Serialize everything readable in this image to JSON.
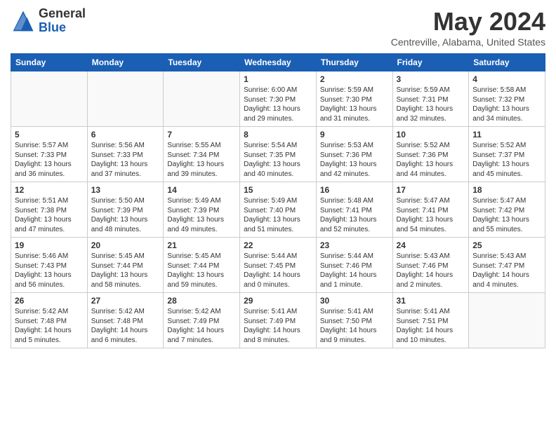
{
  "logo": {
    "general": "General",
    "blue": "Blue"
  },
  "title": "May 2024",
  "location": "Centreville, Alabama, United States",
  "weekdays": [
    "Sunday",
    "Monday",
    "Tuesday",
    "Wednesday",
    "Thursday",
    "Friday",
    "Saturday"
  ],
  "weeks": [
    [
      {
        "day": "",
        "info": ""
      },
      {
        "day": "",
        "info": ""
      },
      {
        "day": "",
        "info": ""
      },
      {
        "day": "1",
        "info": "Sunrise: 6:00 AM\nSunset: 7:30 PM\nDaylight: 13 hours\nand 29 minutes."
      },
      {
        "day": "2",
        "info": "Sunrise: 5:59 AM\nSunset: 7:30 PM\nDaylight: 13 hours\nand 31 minutes."
      },
      {
        "day": "3",
        "info": "Sunrise: 5:59 AM\nSunset: 7:31 PM\nDaylight: 13 hours\nand 32 minutes."
      },
      {
        "day": "4",
        "info": "Sunrise: 5:58 AM\nSunset: 7:32 PM\nDaylight: 13 hours\nand 34 minutes."
      }
    ],
    [
      {
        "day": "5",
        "info": "Sunrise: 5:57 AM\nSunset: 7:33 PM\nDaylight: 13 hours\nand 36 minutes."
      },
      {
        "day": "6",
        "info": "Sunrise: 5:56 AM\nSunset: 7:33 PM\nDaylight: 13 hours\nand 37 minutes."
      },
      {
        "day": "7",
        "info": "Sunrise: 5:55 AM\nSunset: 7:34 PM\nDaylight: 13 hours\nand 39 minutes."
      },
      {
        "day": "8",
        "info": "Sunrise: 5:54 AM\nSunset: 7:35 PM\nDaylight: 13 hours\nand 40 minutes."
      },
      {
        "day": "9",
        "info": "Sunrise: 5:53 AM\nSunset: 7:36 PM\nDaylight: 13 hours\nand 42 minutes."
      },
      {
        "day": "10",
        "info": "Sunrise: 5:52 AM\nSunset: 7:36 PM\nDaylight: 13 hours\nand 44 minutes."
      },
      {
        "day": "11",
        "info": "Sunrise: 5:52 AM\nSunset: 7:37 PM\nDaylight: 13 hours\nand 45 minutes."
      }
    ],
    [
      {
        "day": "12",
        "info": "Sunrise: 5:51 AM\nSunset: 7:38 PM\nDaylight: 13 hours\nand 47 minutes."
      },
      {
        "day": "13",
        "info": "Sunrise: 5:50 AM\nSunset: 7:39 PM\nDaylight: 13 hours\nand 48 minutes."
      },
      {
        "day": "14",
        "info": "Sunrise: 5:49 AM\nSunset: 7:39 PM\nDaylight: 13 hours\nand 49 minutes."
      },
      {
        "day": "15",
        "info": "Sunrise: 5:49 AM\nSunset: 7:40 PM\nDaylight: 13 hours\nand 51 minutes."
      },
      {
        "day": "16",
        "info": "Sunrise: 5:48 AM\nSunset: 7:41 PM\nDaylight: 13 hours\nand 52 minutes."
      },
      {
        "day": "17",
        "info": "Sunrise: 5:47 AM\nSunset: 7:41 PM\nDaylight: 13 hours\nand 54 minutes."
      },
      {
        "day": "18",
        "info": "Sunrise: 5:47 AM\nSunset: 7:42 PM\nDaylight: 13 hours\nand 55 minutes."
      }
    ],
    [
      {
        "day": "19",
        "info": "Sunrise: 5:46 AM\nSunset: 7:43 PM\nDaylight: 13 hours\nand 56 minutes."
      },
      {
        "day": "20",
        "info": "Sunrise: 5:45 AM\nSunset: 7:44 PM\nDaylight: 13 hours\nand 58 minutes."
      },
      {
        "day": "21",
        "info": "Sunrise: 5:45 AM\nSunset: 7:44 PM\nDaylight: 13 hours\nand 59 minutes."
      },
      {
        "day": "22",
        "info": "Sunrise: 5:44 AM\nSunset: 7:45 PM\nDaylight: 14 hours\nand 0 minutes."
      },
      {
        "day": "23",
        "info": "Sunrise: 5:44 AM\nSunset: 7:46 PM\nDaylight: 14 hours\nand 1 minute."
      },
      {
        "day": "24",
        "info": "Sunrise: 5:43 AM\nSunset: 7:46 PM\nDaylight: 14 hours\nand 2 minutes."
      },
      {
        "day": "25",
        "info": "Sunrise: 5:43 AM\nSunset: 7:47 PM\nDaylight: 14 hours\nand 4 minutes."
      }
    ],
    [
      {
        "day": "26",
        "info": "Sunrise: 5:42 AM\nSunset: 7:48 PM\nDaylight: 14 hours\nand 5 minutes."
      },
      {
        "day": "27",
        "info": "Sunrise: 5:42 AM\nSunset: 7:48 PM\nDaylight: 14 hours\nand 6 minutes."
      },
      {
        "day": "28",
        "info": "Sunrise: 5:42 AM\nSunset: 7:49 PM\nDaylight: 14 hours\nand 7 minutes."
      },
      {
        "day": "29",
        "info": "Sunrise: 5:41 AM\nSunset: 7:49 PM\nDaylight: 14 hours\nand 8 minutes."
      },
      {
        "day": "30",
        "info": "Sunrise: 5:41 AM\nSunset: 7:50 PM\nDaylight: 14 hours\nand 9 minutes."
      },
      {
        "day": "31",
        "info": "Sunrise: 5:41 AM\nSunset: 7:51 PM\nDaylight: 14 hours\nand 10 minutes."
      },
      {
        "day": "",
        "info": ""
      }
    ]
  ]
}
